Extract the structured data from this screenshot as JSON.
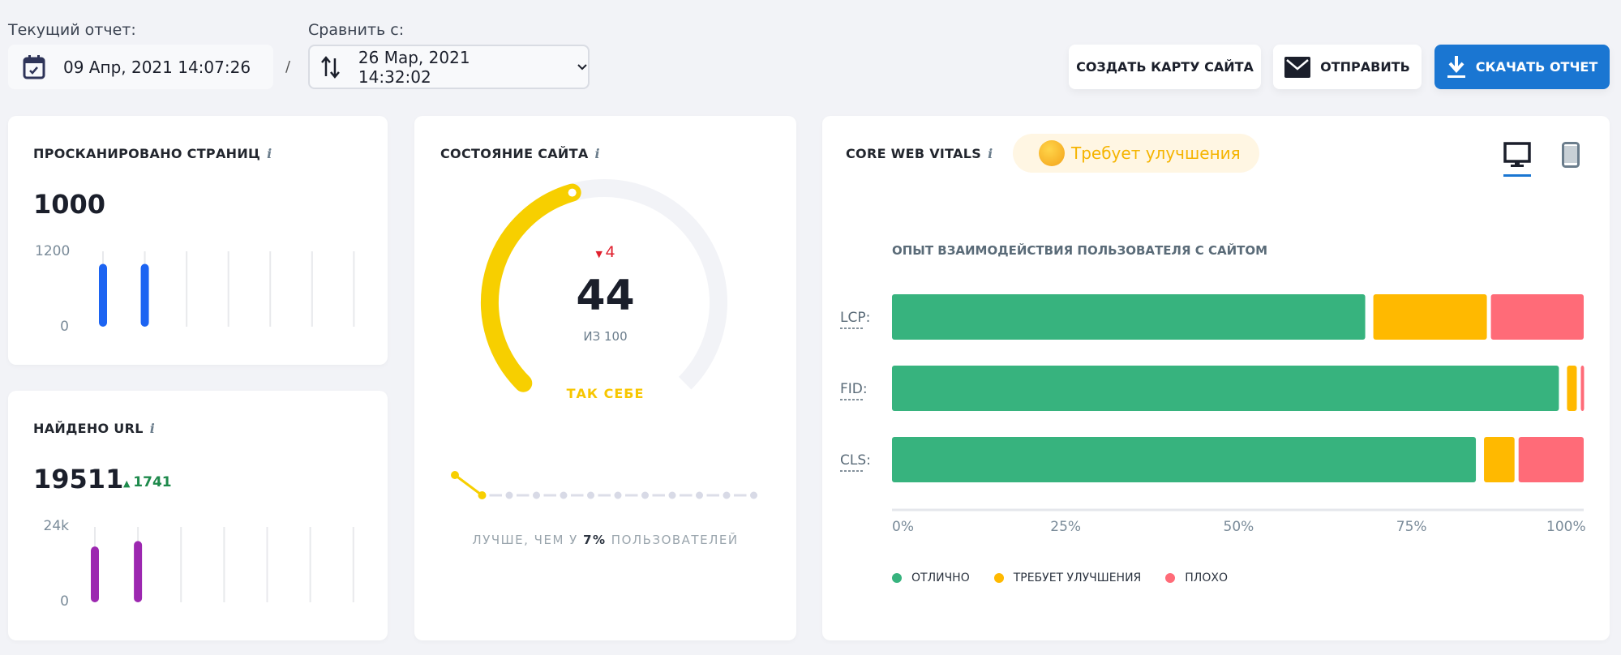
{
  "header": {
    "current_label": "Текущий отчет:",
    "current_value": "09 Апр, 2021 14:07:26",
    "separator": "/",
    "compare_label": "Сравнить с:",
    "compare_value": "26 Мар, 2021 14:32:02",
    "buttons": {
      "sitemap": "СОЗДАТЬ КАРТУ САЙТА",
      "send": "ОТПРАВИТЬ",
      "download": "СКАЧАТЬ ОТЧЕТ"
    }
  },
  "colors": {
    "accent": "#1a76d2",
    "good": "#37b37e",
    "needs": "#ffb900",
    "poor": "#ff6b78",
    "gauge": "#f7cf00",
    "pages_bar": "#1c64f2",
    "urls_bar": "#9c27b0"
  },
  "pages": {
    "title": "ПРОСКАНИРОВАНО СТРАНИЦ",
    "info": "i",
    "value": "1000",
    "chart_data": {
      "type": "bar",
      "ylim": [
        0,
        1200
      ],
      "yticks": [
        "1200",
        "0"
      ],
      "values": [
        1000,
        1000
      ],
      "slots": 7
    }
  },
  "urls": {
    "title": "НАЙДЕНО URL",
    "info": "i",
    "value": "19511",
    "delta": "1741",
    "chart_data": {
      "type": "bar",
      "ylim": [
        0,
        24000
      ],
      "yticks": [
        "24k",
        "0"
      ],
      "values": [
        17770,
        19511
      ],
      "slots": 7
    }
  },
  "health": {
    "title": "СОСТОЯНИЕ САЙТА",
    "info": "i",
    "delta": "4",
    "score": "44",
    "out_of": "ИЗ 100",
    "status": "ТАК СЕБЕ",
    "score_value": 44,
    "percentile_prefix": "ЛУЧШЕ, ЧЕМ У ",
    "percentile": "7%",
    "percentile_suffix": " ПОЛЬЗОВАТЕЛЕЙ",
    "percentile_points": 12,
    "percentile_active": 2
  },
  "cwv": {
    "title": "CORE WEB VITALS",
    "info": "i",
    "badge": "Требует улучшения",
    "device_active": "desktop",
    "chart_data": {
      "type": "bar",
      "orientation": "horizontal",
      "stacked": true,
      "title": "ОПЫТ ВЗАИМОДЕЙСТВИЯ ПОЛЬЗОВАТЕЛЯ С САЙТОМ",
      "categories": [
        "LCP:",
        "FID:",
        "CLS:"
      ],
      "series": [
        {
          "name": "ОТЛИЧНО",
          "values": [
            69,
            97,
            85
          ]
        },
        {
          "name": "ТРЕБУЕТ УЛУЧШЕНИЯ",
          "values": [
            17,
            2,
            5
          ]
        },
        {
          "name": "ПЛОХО",
          "values": [
            14,
            1,
            10
          ]
        }
      ],
      "xticks": [
        "0%",
        "25%",
        "50%",
        "75%",
        "100%"
      ],
      "xlim": [
        0,
        100
      ],
      "legend": "bottom-left"
    }
  }
}
